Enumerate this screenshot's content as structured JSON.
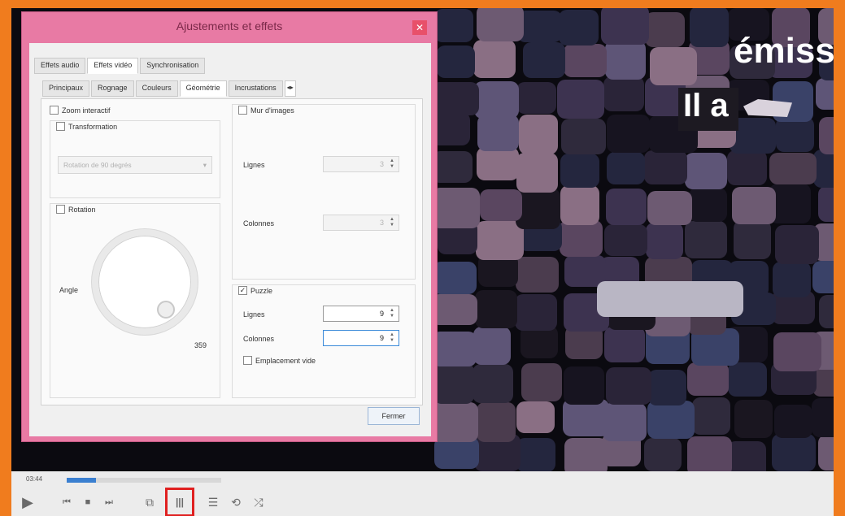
{
  "dialog": {
    "title": "Ajustements et effets",
    "close_glyph": "✕",
    "tabs": [
      "Effets audio",
      "Effets vidéo",
      "Synchronisation"
    ],
    "subtabs": [
      "Principaux",
      "Rognage",
      "Couleurs",
      "Géométrie",
      "Incrustations"
    ],
    "subtab_scroll": "◂▸",
    "left": {
      "zoom_label": "Zoom interactif",
      "transform_label": "Transformation",
      "transform_select": "Rotation de 90 degrés",
      "rotation_label": "Rotation",
      "angle_label": "Angle",
      "dial_value": "359"
    },
    "wall": {
      "label": "Mur d'images",
      "lines_label": "Lignes",
      "lines_value": "3",
      "cols_label": "Colonnes",
      "cols_value": "3"
    },
    "puzzle": {
      "label": "Puzzle",
      "checked": "✓",
      "lines_label": "Lignes",
      "lines_value": "9",
      "cols_label": "Colonnes",
      "cols_value": "9",
      "blank_label": "Emplacement vide"
    },
    "close_button": "Fermer"
  },
  "video": {
    "overlay_line1": "émiss",
    "overlay_line2": "Il a"
  },
  "controls": {
    "time": "03:44",
    "progress": 0.19,
    "buttons": [
      "▶",
      "⏮",
      "■",
      "⏭",
      "⧉",
      "|||",
      "☰",
      "⟲",
      "⤮"
    ]
  },
  "colors": {
    "frame": "#f07c1e",
    "dialog": "#e87aa4",
    "highlight": "#e02020"
  }
}
